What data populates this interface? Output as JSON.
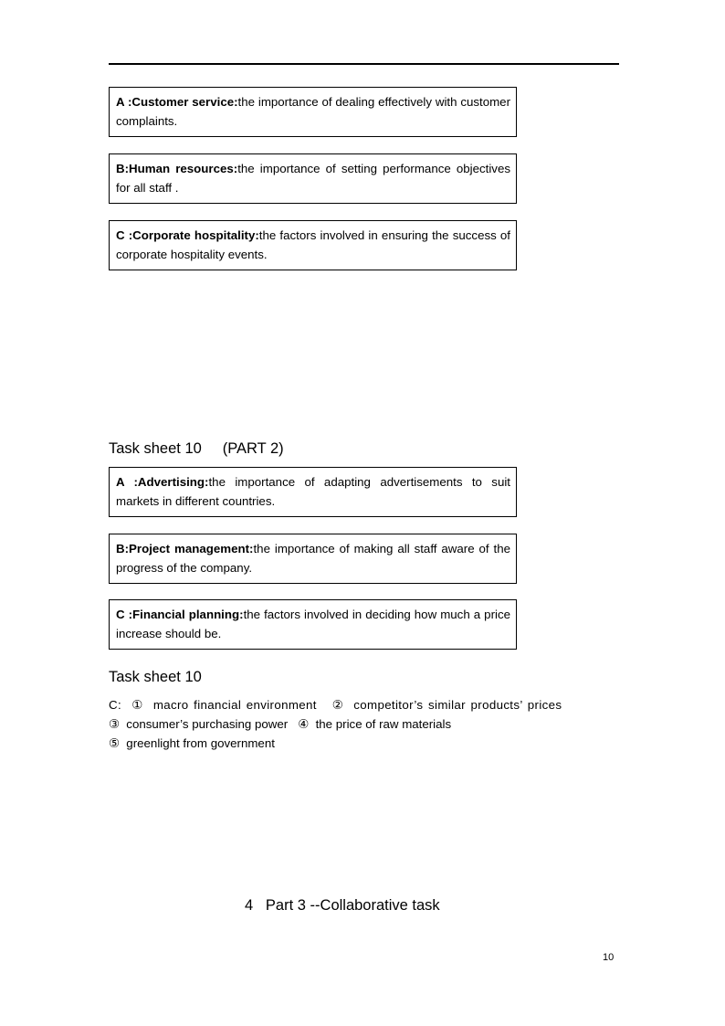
{
  "document": {
    "page_number": "10",
    "divider": "horizontal-rule"
  },
  "section_part1": {
    "items": [
      {
        "lead": "A :Customer service:",
        "text": "the importance of dealing effectively with customer complaints."
      },
      {
        "lead": "B:Human  resources:",
        "text": "the importance of setting performance objectives for all staff ."
      },
      {
        "lead": "C :Corporate hospitality:",
        "text": "the factors involved in ensuring the success of corporate hospitality events."
      }
    ]
  },
  "section_part2": {
    "heading": "Task sheet 10     (PART 2)",
    "items": [
      {
        "lead": "A :Advertising:",
        "text": "the importance of adapting advertisements to suit markets in different countries."
      },
      {
        "lead": "B:Project management:",
        "text": "the importance of making all staff aware of the progress of the company."
      },
      {
        "lead": "C :Financial  planning:",
        "text": "the factors involved in deciding how much a price increase should be."
      }
    ]
  },
  "section_answers": {
    "heading": "Task sheet 10",
    "label": "C:",
    "lines": [
      "C:  ①  macro financial environment   ②  competitor’s similar products’ prices",
      "③  consumer’s purchasing power   ④  the price of raw materials",
      "⑤  greenlight from government"
    ],
    "items": [
      {
        "marker": "①",
        "text": "macro financial environment"
      },
      {
        "marker": "②",
        "text": "competitor’s similar products’ prices"
      },
      {
        "marker": "③",
        "text": "consumer’s purchasing power"
      },
      {
        "marker": "④",
        "text": "the price of raw materials"
      },
      {
        "marker": "⑤",
        "text": "greenlight from government"
      }
    ]
  },
  "section_footer": {
    "heading": "4   Part 3 --Collaborative task"
  }
}
